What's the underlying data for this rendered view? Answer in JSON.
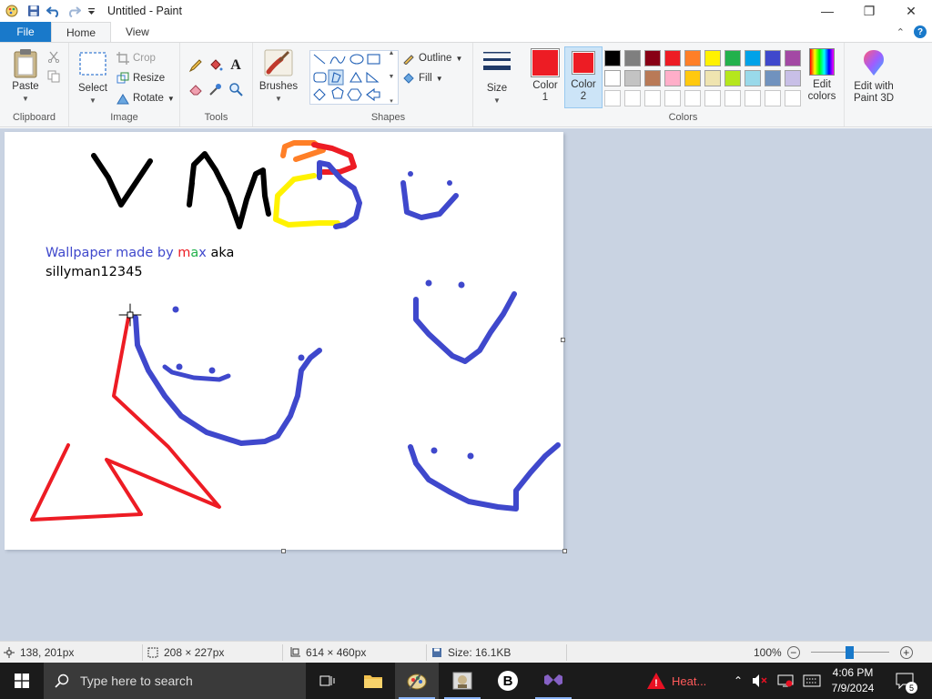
{
  "window": {
    "title": "Untitled - Paint",
    "minimize": "—",
    "maximize": "❐",
    "close": "✕"
  },
  "tabs": [
    "File",
    "Home",
    "View"
  ],
  "ribbon": {
    "clipboard": {
      "paste": "Paste",
      "label": "Clipboard"
    },
    "image": {
      "select": "Select",
      "crop": "Crop",
      "resize": "Resize",
      "rotate": "Rotate",
      "label": "Image"
    },
    "tools": {
      "label": "Tools"
    },
    "brushes": {
      "label": "Brushes"
    },
    "shapes": {
      "outline": "Outline",
      "fill": "Fill",
      "label": "Shapes"
    },
    "size": {
      "label": "Size"
    },
    "colors": {
      "color1": "Color\n1",
      "color1_line1": "Color",
      "color1_line2": "1",
      "color2_line1": "Color",
      "color2_line2": "2",
      "color1_value": "#ed1c24",
      "color2_value": "#ed1c24",
      "edit_line1": "Edit",
      "edit_line2": "colors",
      "label": "Colors",
      "palette_row1": [
        "#000000",
        "#7f7f7f",
        "#880015",
        "#ed1c24",
        "#ff7f27",
        "#fff200",
        "#22b14c",
        "#00a2e8",
        "#3f48cc",
        "#a349a4"
      ],
      "palette_row2": [
        "#ffffff",
        "#c3c3c3",
        "#b97a57",
        "#ffaec9",
        "#ffc90e",
        "#efe4b0",
        "#b5e61d",
        "#99d9ea",
        "#7092be",
        "#c8bfe7"
      ]
    },
    "paint3d": {
      "line1": "Edit with",
      "line2": "Paint 3D"
    }
  },
  "canvas_text": {
    "part1": "Wallpaper made by ",
    "m": "m",
    "a": "a",
    "x": "x",
    "aka": " aka",
    "line2": "sillyman12345"
  },
  "status": {
    "cursor_pos": "138, 201px",
    "selection_size": "208 × 227px",
    "image_size": "614 × 460px",
    "file_size": "Size: 16.1KB",
    "zoom": "100%",
    "zoom_level": 1.0
  },
  "taskbar": {
    "search_placeholder": "Type here to search",
    "notification_label": "Heat...",
    "time": "4:06 PM",
    "date": "7/9/2024",
    "notification_count": "5"
  }
}
